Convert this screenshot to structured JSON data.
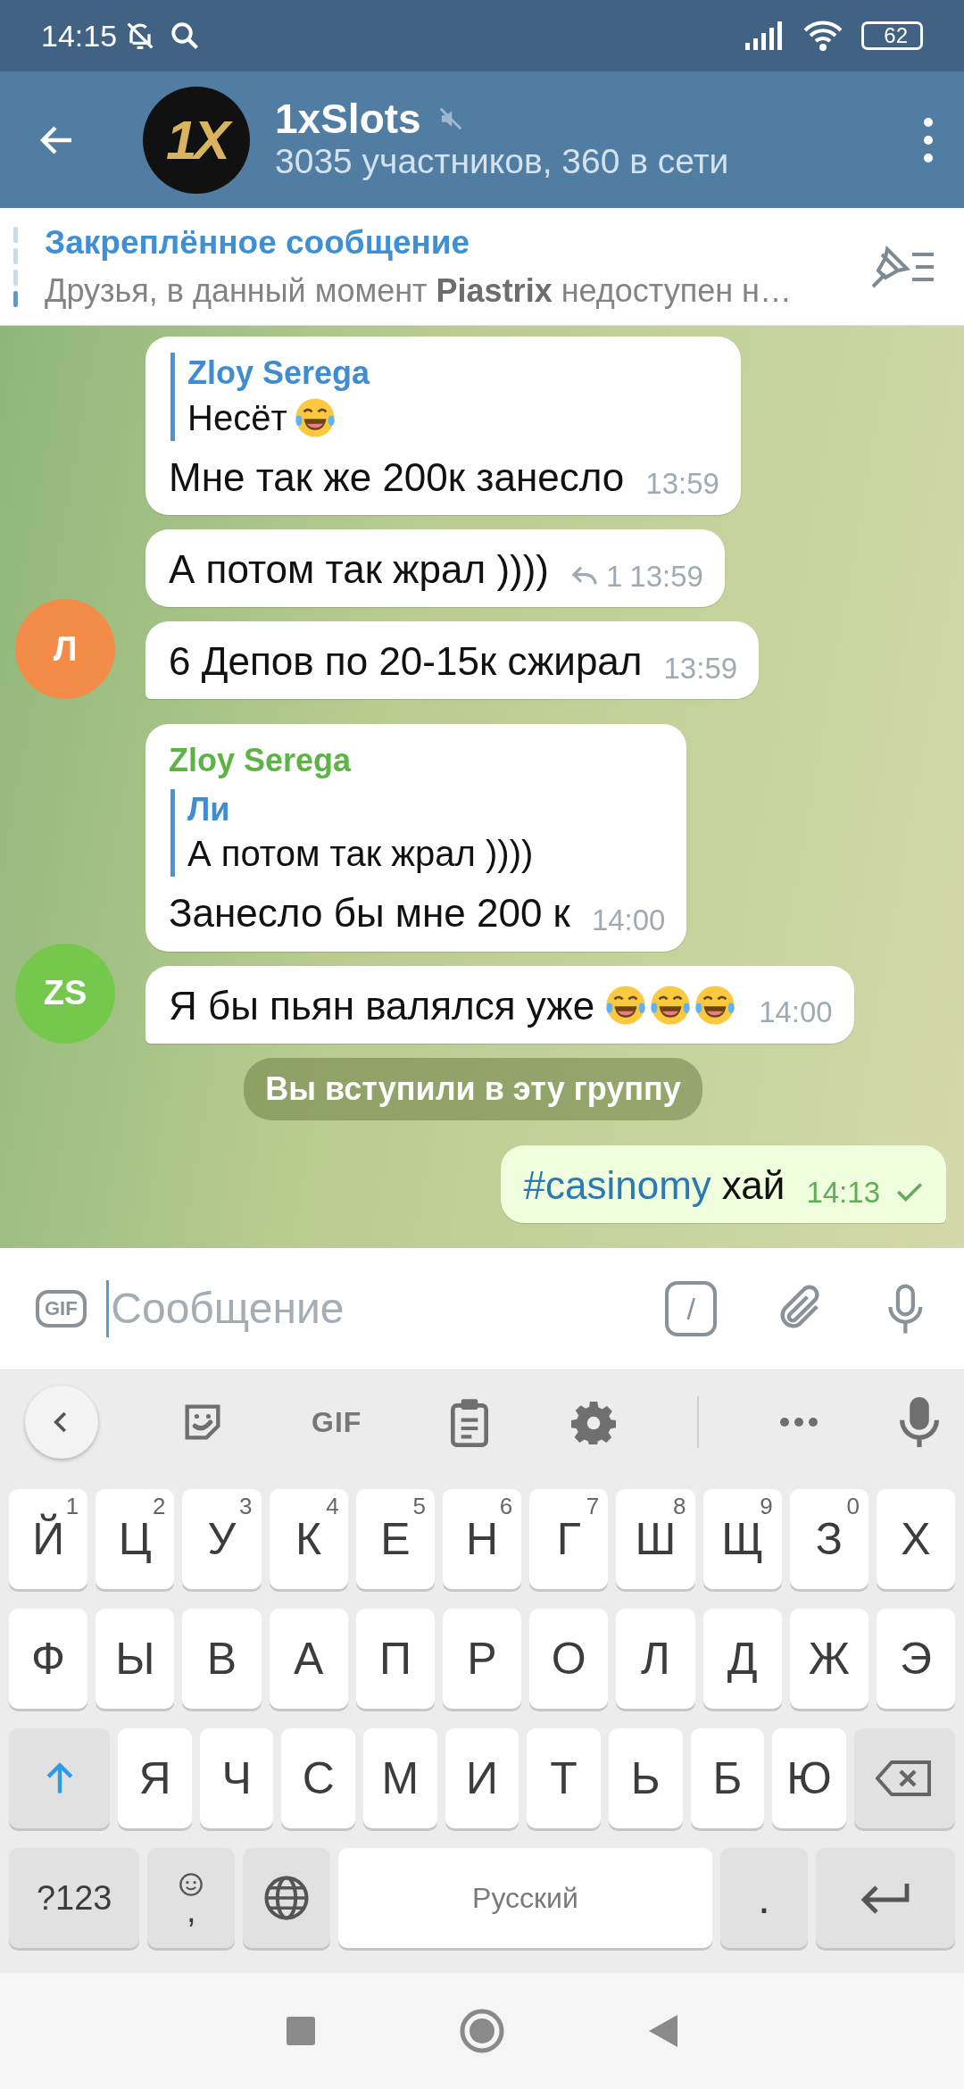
{
  "status_bar": {
    "time": "14:15",
    "battery": "62"
  },
  "header": {
    "avatar_text": "1X",
    "title": "1xSlots",
    "muted": true,
    "subtitle": "3035 участников, 360 в сети"
  },
  "pinned": {
    "title": "Закреплённое сообщение",
    "text": "Друзья, в данный момент **Piastrix** недоступен н…"
  },
  "messages": [
    {
      "kind": "incoming",
      "reply": {
        "name": "Zloy Serega",
        "text": "Несёт",
        "emojis": [
          {
            "kind": "tears-of-joy"
          }
        ]
      },
      "text": "Мне так же 200к занесло",
      "time": "13:59"
    },
    {
      "kind": "incoming",
      "text": "А потом так жрал ))))",
      "replies": "1",
      "time": "13:59"
    },
    {
      "kind": "incoming",
      "text": "6 Депов по 20-15к сжирал",
      "time": "13:59",
      "avatar": {
        "initials": "Л",
        "color": "#f28c48"
      }
    },
    {
      "kind": "incoming",
      "sender": {
        "name": "Zloy Serega",
        "color": "#5db346"
      },
      "reply": {
        "name": "Ли",
        "text": "А потом так жрал ))))"
      },
      "text": "Занесло бы мне 200 к",
      "time": "14:00"
    },
    {
      "kind": "incoming",
      "text": "Я бы пьян валялся уже",
      "emojis": [
        {
          "kind": "tears-of-joy"
        },
        {
          "kind": "tears-of-joy"
        },
        {
          "kind": "tears-of-joy"
        }
      ],
      "time": "14:00",
      "avatar": {
        "initials": "ZS",
        "color": "#76c84d"
      }
    },
    {
      "kind": "service",
      "text": "Вы вступили в эту группу"
    },
    {
      "kind": "outgoing",
      "hashtag": "#casinomy",
      "text": "хай",
      "time": "14:13",
      "read": false
    }
  ],
  "input": {
    "gif_label": "GIF",
    "placeholder": "Сообщение",
    "command_label": "/"
  },
  "keyboard": {
    "toolbar": {
      "gif_label": "GIF"
    },
    "rows": [
      [
        {
          "kind": "letter",
          "label": "Й",
          "hint": "1"
        },
        {
          "kind": "letter",
          "label": "Ц",
          "hint": "2"
        },
        {
          "kind": "letter",
          "label": "У",
          "hint": "3"
        },
        {
          "kind": "letter",
          "label": "К",
          "hint": "4"
        },
        {
          "kind": "letter",
          "label": "Е",
          "hint": "5"
        },
        {
          "kind": "letter",
          "label": "Н",
          "hint": "6"
        },
        {
          "kind": "letter",
          "label": "Г",
          "hint": "7"
        },
        {
          "kind": "letter",
          "label": "Ш",
          "hint": "8"
        },
        {
          "kind": "letter",
          "label": "Щ",
          "hint": "9"
        },
        {
          "kind": "letter",
          "label": "З",
          "hint": "0"
        },
        {
          "kind": "letter",
          "label": "Х"
        }
      ],
      [
        {
          "kind": "letter",
          "label": "Ф"
        },
        {
          "kind": "letter",
          "label": "Ы"
        },
        {
          "kind": "letter",
          "label": "В"
        },
        {
          "kind": "letter",
          "label": "А"
        },
        {
          "kind": "letter",
          "label": "П"
        },
        {
          "kind": "letter",
          "label": "Р"
        },
        {
          "kind": "letter",
          "label": "О"
        },
        {
          "kind": "letter",
          "label": "Л"
        },
        {
          "kind": "letter",
          "label": "Д"
        },
        {
          "kind": "letter",
          "label": "Ж"
        },
        {
          "kind": "letter",
          "label": "Э"
        }
      ],
      [
        {
          "kind": "shift",
          "on": true
        },
        {
          "kind": "letter",
          "label": "Я"
        },
        {
          "kind": "letter",
          "label": "Ч"
        },
        {
          "kind": "letter",
          "label": "С"
        },
        {
          "kind": "letter",
          "label": "М"
        },
        {
          "kind": "letter",
          "label": "И"
        },
        {
          "kind": "letter",
          "label": "Т"
        },
        {
          "kind": "letter",
          "label": "Ь"
        },
        {
          "kind": "letter",
          "label": "Б"
        },
        {
          "kind": "letter",
          "label": "Ю"
        },
        {
          "kind": "backspace"
        }
      ]
    ],
    "bottom_row": {
      "symbols_label": "?123",
      "comma_label": ",",
      "space_label": "Русский",
      "period_label": "."
    }
  }
}
